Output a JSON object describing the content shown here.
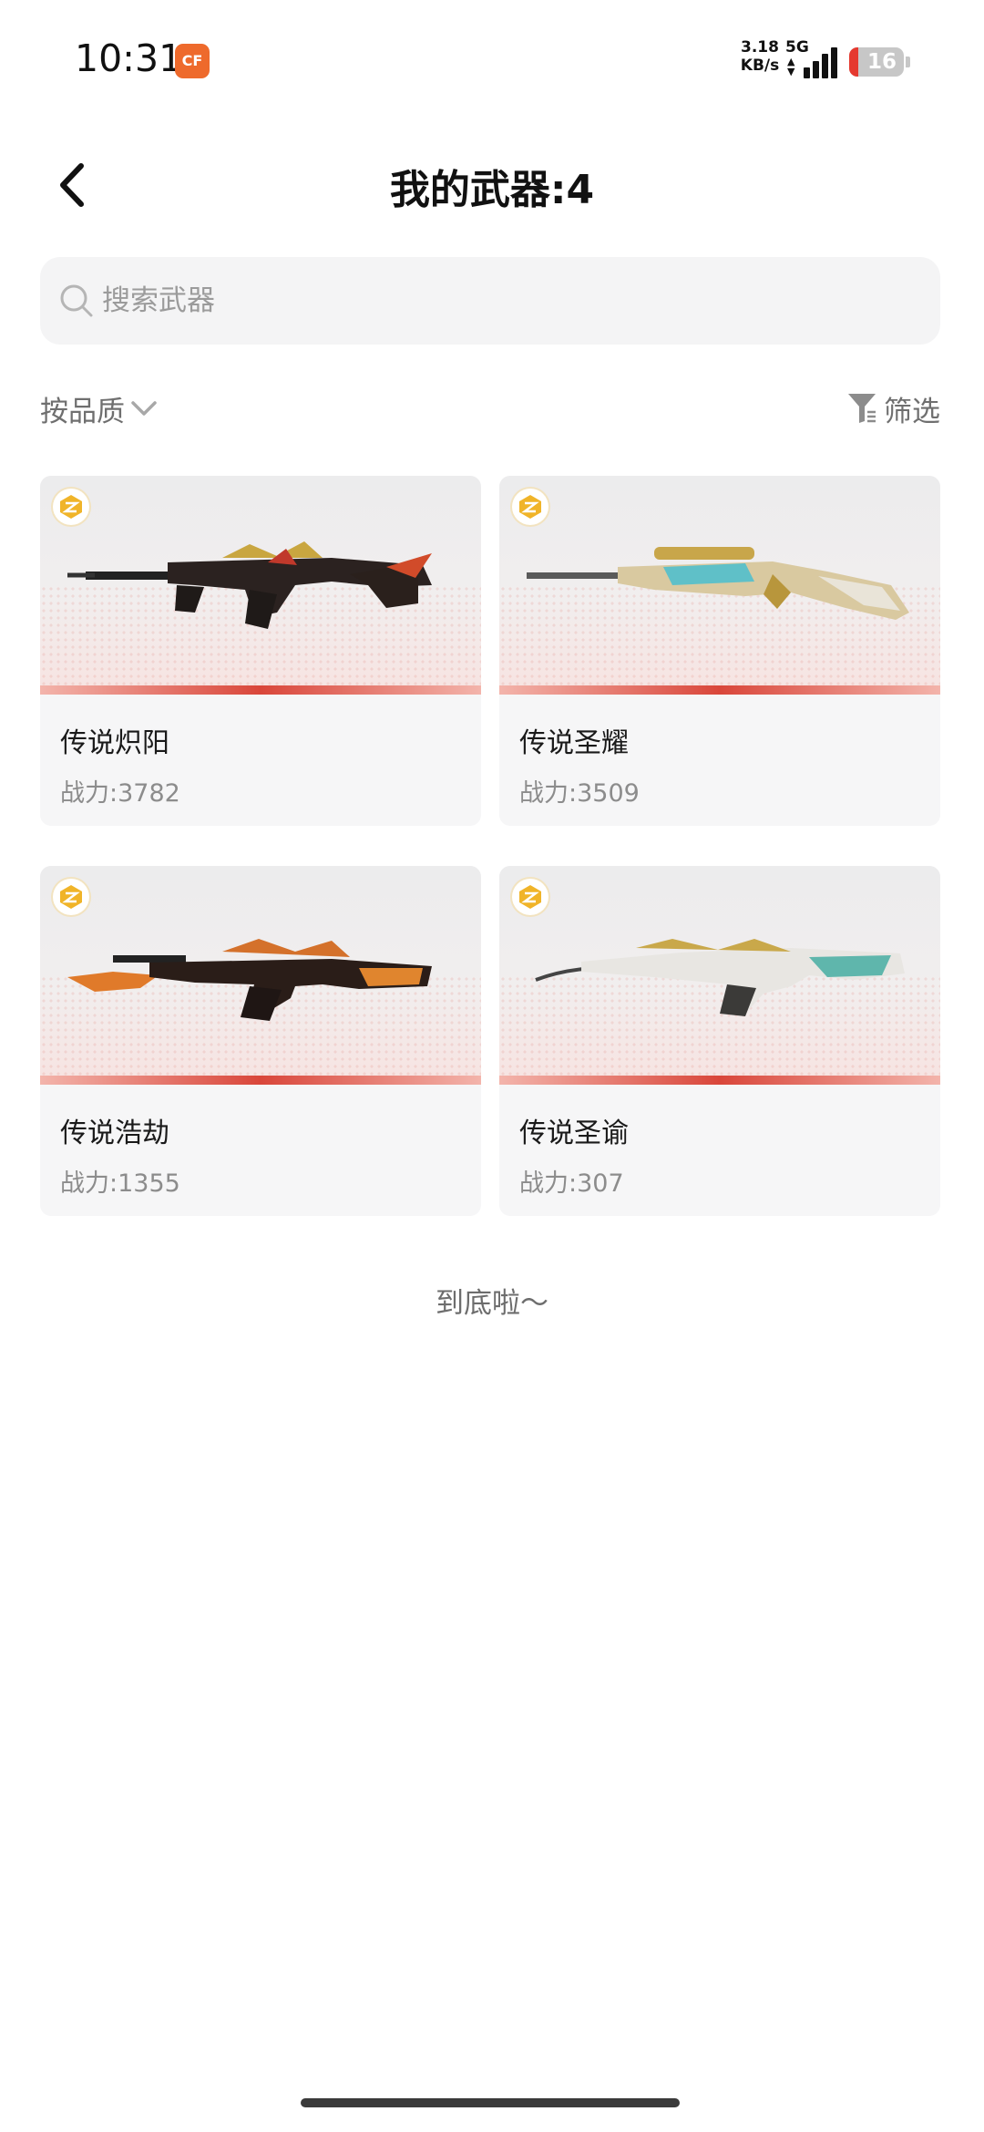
{
  "status_bar": {
    "time": "10:31",
    "app_icon": "crossfire-app-icon",
    "net_speed_value": "3.18",
    "net_speed_unit": "KB/s",
    "network_type": "5G",
    "battery_level": "16",
    "battery_color": "#e5392f"
  },
  "header": {
    "title": "我的武器:4",
    "back_icon": "chevron-left-icon"
  },
  "search": {
    "placeholder": "搜索武器",
    "value": ""
  },
  "filters": {
    "sort_label": "按品质",
    "filter_label": "筛选"
  },
  "weapons": [
    {
      "name": "传说炽阳",
      "power": "战力:3782"
    },
    {
      "name": "传说圣耀",
      "power": "战力:3509"
    },
    {
      "name": "传说浩劫",
      "power": "战力:1355"
    },
    {
      "name": "传说圣谕",
      "power": "战力:307"
    }
  ],
  "footer": {
    "end_text": "到底啦～"
  },
  "colors": {
    "accent_red": "#d9463a",
    "card_bg": "#f6f6f7",
    "badge_gold": "#f0b429"
  }
}
